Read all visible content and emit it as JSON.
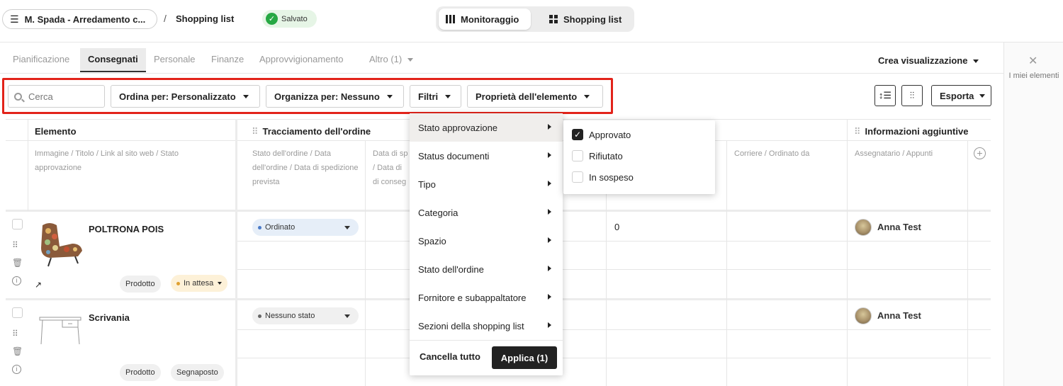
{
  "header": {
    "project": "M. Spada - Arredamento c...",
    "separator": "/",
    "page": "Shopping list",
    "saved": "Salvato",
    "views": [
      "Monitoraggio",
      "Shopping list"
    ]
  },
  "rail": {
    "label": "I miei elementi"
  },
  "tabs": [
    "Pianificazione",
    "Consegnati",
    "Personale",
    "Finanze",
    "Approvvigionamento",
    "Altro (1)"
  ],
  "create_view": "Crea visualizzazione",
  "toolbar": {
    "search_placeholder": "Cerca",
    "sort": "Ordina per: Personalizzato",
    "group": "Organizza per: Nessuno",
    "filters": "Filtri",
    "properties": "Proprietà dell'elemento",
    "export": "Esporta"
  },
  "columns": {
    "elemento": "Elemento",
    "elemento_sub": "Immagine / Titolo / Link al sito web / Stato approvazione",
    "tracking": "Tracciamento dell'ordine",
    "tracking_sub1": "Stato dell'ordine / Data dell'ordine / Data di spedizione prevista",
    "tracking_sub2": "Data di sp / Data di di conseg",
    "carrier_sub": "Corriere / Ordinato da",
    "info": "Informazioni aggiuntive",
    "info_sub": "Assegnatario / Appunti"
  },
  "rows": [
    {
      "name": "POLTRONA POIS",
      "type": "Prodotto",
      "approval": "In attesa",
      "order_status": "Ordinato",
      "qty": "0",
      "assignee": "Anna Test"
    },
    {
      "name": "Scrivania",
      "type": "Prodotto",
      "approval": "Segnaposto",
      "order_status": "Nessuno stato",
      "qty": "",
      "assignee": "Anna Test"
    }
  ],
  "menu": {
    "items": [
      "Stato approvazione",
      "Status documenti",
      "Tipo",
      "Categoria",
      "Spazio",
      "Stato dell'ordine",
      "Fornitore e subappaltatore",
      "Sezioni della shopping list"
    ],
    "cancel": "Cancella tutto",
    "apply": "Applica (1)"
  },
  "submenu": {
    "options": [
      {
        "label": "Approvato",
        "checked": true
      },
      {
        "label": "Rifiutato",
        "checked": false
      },
      {
        "label": "In sospeso",
        "checked": false
      }
    ]
  },
  "colors": {
    "accent_red": "#e2231a",
    "saved_green": "#27a844",
    "dark": "#222222"
  },
  "icons": [
    "hamburger-icon",
    "check-circle-icon",
    "columns-icon",
    "grid-icon",
    "wand-icon",
    "search-icon",
    "sort-lines-icon",
    "sliders-icon",
    "drag-handle-icon",
    "trash-icon",
    "info-icon",
    "external-link-icon",
    "plus-circle-icon"
  ]
}
